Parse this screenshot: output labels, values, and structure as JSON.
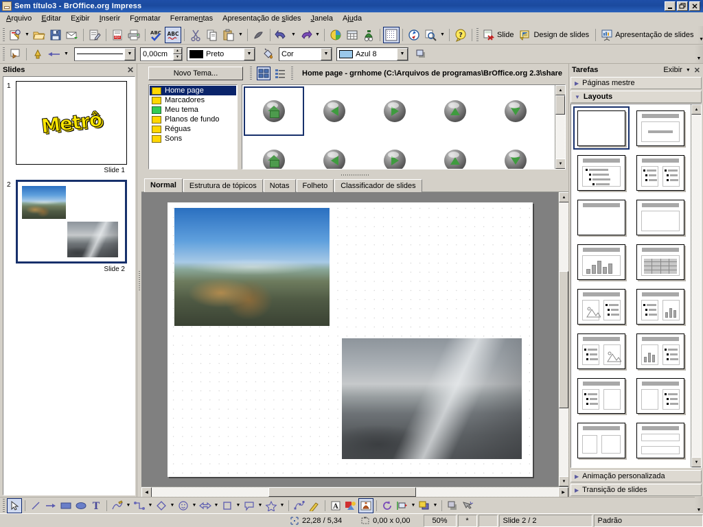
{
  "window": {
    "title": "Sem título3 - BrOffice.org Impress",
    "app_icon": "impress-document-icon",
    "buttons": {
      "minimize": "_",
      "restore": "❐",
      "close": "✕"
    }
  },
  "menubar": {
    "items": [
      {
        "label": "Arquivo",
        "accel": "A"
      },
      {
        "label": "Editar",
        "accel": "E"
      },
      {
        "label": "Exibir",
        "accel": "x"
      },
      {
        "label": "Inserir",
        "accel": "I"
      },
      {
        "label": "Formatar",
        "accel": "o"
      },
      {
        "label": "Ferramentas",
        "accel": "n"
      },
      {
        "label": "Apresentação de slides",
        "accel": "s"
      },
      {
        "label": "Janela",
        "accel": "J"
      },
      {
        "label": "Ajuda",
        "accel": "u"
      }
    ]
  },
  "standard_toolbar": {
    "buttons": [
      {
        "name": "new-document-icon",
        "tip": "Novo"
      },
      {
        "name": "new-document-dropdown-icon",
        "tip": "Novo"
      },
      {
        "name": "open-icon",
        "tip": "Abrir"
      },
      {
        "name": "save-icon",
        "tip": "Salvar"
      },
      {
        "name": "email-document-icon",
        "tip": "Documento como e-mail"
      },
      {
        "name": "edit-file-icon",
        "tip": "Editar arquivo"
      },
      {
        "name": "export-pdf-icon",
        "tip": "Exportar diretamente como PDF"
      },
      {
        "name": "print-icon",
        "tip": "Imprimir arquivo diretamente"
      },
      {
        "name": "spellcheck-icon",
        "tip": "Verificação ortográfica"
      },
      {
        "name": "autospellcheck-icon",
        "tip": "Autoverificação ortográfica"
      },
      {
        "name": "cut-icon",
        "tip": "Cortar"
      },
      {
        "name": "copy-icon",
        "tip": "Copiar"
      },
      {
        "name": "paste-icon",
        "tip": "Colar"
      },
      {
        "name": "paste-dropdown-icon",
        "tip": "Colar"
      },
      {
        "name": "clone-formatting-icon",
        "tip": "Pincel de estilo"
      },
      {
        "name": "undo-icon",
        "tip": "Desfazer"
      },
      {
        "name": "undo-dropdown-icon",
        "tip": "Desfazer"
      },
      {
        "name": "redo-icon",
        "tip": "Refazer"
      },
      {
        "name": "redo-dropdown-icon",
        "tip": "Refazer"
      },
      {
        "name": "insert-chart-icon",
        "tip": "Gráfico"
      },
      {
        "name": "insert-table-icon",
        "tip": "Tabela"
      },
      {
        "name": "gallery-icon",
        "tip": "Galeria"
      },
      {
        "name": "display-grid-icon",
        "tip": "Exibir grade"
      },
      {
        "name": "hyperlink-icon",
        "tip": "Hyperlink"
      },
      {
        "name": "zoom-icon",
        "tip": "Zoom"
      },
      {
        "name": "zoom-dropdown-icon",
        "tip": "Zoom"
      },
      {
        "name": "help-icon",
        "tip": "Ajuda do BrOffice.org"
      }
    ],
    "labeled_buttons": [
      {
        "name": "new-slide-button",
        "label": "Slide",
        "icon": "new-slide-icon"
      },
      {
        "name": "slide-design-button",
        "label": "Design de slides",
        "icon": "slide-design-icon"
      },
      {
        "name": "slide-show-button",
        "label": "Apresentação de slides",
        "icon": "slide-show-icon"
      }
    ]
  },
  "line_and_fill_toolbar": {
    "select_icon": "line-fill-select-icon",
    "line_endpoint_icon": "line-endpoint-icon",
    "arrow_style_icon": "arrow-style-icon",
    "line_style": {
      "name": "line-style-combo",
      "value": ""
    },
    "line_width": {
      "name": "line-width-field",
      "value": "0,00cm"
    },
    "line_color": {
      "name": "line-color-combo",
      "value": "Preto",
      "hex": "#000000"
    },
    "fill_bucket_icon": "fill-bucket-icon",
    "area_style": {
      "name": "area-style-combo",
      "value": "Cor"
    },
    "area_fill": {
      "name": "area-fill-combo",
      "value": "Azul 8",
      "hex": "#99ccee"
    },
    "shadow_icon": "shadow-icon"
  },
  "slides_panel": {
    "title": "Slides",
    "close_icon": "close-icon",
    "slides": [
      {
        "number": "1",
        "label": "Slide 1",
        "selected": false,
        "content": "Metrô"
      },
      {
        "number": "2",
        "label": "Slide 2",
        "selected": true,
        "content": ""
      }
    ]
  },
  "gallery": {
    "new_theme_button": "Novo Tema...",
    "view_icon_button": "gallery-icon-view-icon",
    "view_list_button": "gallery-list-view-icon",
    "title": "Home page - grnhome (C:\\Arquivos de programas\\BrOffice.org 2.3\\share",
    "themes": [
      {
        "label": "Home page",
        "selected": true,
        "folder_color": "#ffd700"
      },
      {
        "label": "Marcadores",
        "selected": false,
        "folder_color": "#ffd700"
      },
      {
        "label": "Meu tema",
        "selected": false,
        "folder_color": "#33cc55"
      },
      {
        "label": "Planos de fundo",
        "selected": false,
        "folder_color": "#ffd700"
      },
      {
        "label": "Réguas",
        "selected": false,
        "folder_color": "#ffd700"
      },
      {
        "label": "Sons",
        "selected": false,
        "folder_color": "#ffd700"
      }
    ],
    "items": [
      {
        "name": "gallery-item-home",
        "glyph": "home",
        "selected": true
      },
      {
        "name": "gallery-item-left",
        "glyph": "left",
        "selected": false
      },
      {
        "name": "gallery-item-right",
        "glyph": "right",
        "selected": false
      },
      {
        "name": "gallery-item-up",
        "glyph": "up",
        "selected": false
      },
      {
        "name": "gallery-item-down",
        "glyph": "down",
        "selected": false
      },
      {
        "name": "gallery-item-home-2",
        "glyph": "home",
        "selected": false
      },
      {
        "name": "gallery-item-left-2",
        "glyph": "left",
        "selected": false
      },
      {
        "name": "gallery-item-right-2",
        "glyph": "right",
        "selected": false
      },
      {
        "name": "gallery-item-up-2",
        "glyph": "up",
        "selected": false
      },
      {
        "name": "gallery-item-down-2",
        "glyph": "down",
        "selected": false
      }
    ]
  },
  "view_tabs": [
    {
      "label": "Normal",
      "selected": true
    },
    {
      "label": "Estrutura de tópicos",
      "selected": false
    },
    {
      "label": "Notas",
      "selected": false
    },
    {
      "label": "Folheto",
      "selected": false
    },
    {
      "label": "Classificador de slides",
      "selected": false
    }
  ],
  "tasks_panel": {
    "title": "Tarefas",
    "view_label": "Exibir",
    "dropdown_icon": "chevron-down-icon",
    "close_icon": "close-icon",
    "sections": [
      {
        "label": "Páginas mestre",
        "open": false
      },
      {
        "label": "Layouts",
        "open": true
      },
      {
        "label": "Animação personalizada",
        "open": false
      },
      {
        "label": "Transição de slides",
        "open": false
      }
    ],
    "layouts": [
      {
        "name": "layout-blank",
        "kind": "blank",
        "selected": true
      },
      {
        "name": "layout-title-subtitle",
        "kind": "title-subtitle",
        "selected": false
      },
      {
        "name": "layout-title-content",
        "kind": "title-bullets",
        "selected": false
      },
      {
        "name": "layout-title-two-content",
        "kind": "title-two-bullets",
        "selected": false
      },
      {
        "name": "layout-title-only",
        "kind": "title-only",
        "selected": false
      },
      {
        "name": "layout-title-object",
        "kind": "title-object",
        "selected": false
      },
      {
        "name": "layout-title-chart",
        "kind": "title-chart",
        "selected": false
      },
      {
        "name": "layout-title-table",
        "kind": "title-table",
        "selected": false
      },
      {
        "name": "layout-title-clipart-content",
        "kind": "title-clip-bullets",
        "selected": false
      },
      {
        "name": "layout-title-content-chart",
        "kind": "title-bullets-chart",
        "selected": false
      },
      {
        "name": "layout-title-content-clipart",
        "kind": "title-bullets-clip",
        "selected": false
      },
      {
        "name": "layout-title-chart-content",
        "kind": "title-chart-bullets",
        "selected": false
      },
      {
        "name": "layout-title-content-object",
        "kind": "title-bullets-obj",
        "selected": false
      },
      {
        "name": "layout-title-content-content",
        "kind": "title-bullets-bullets",
        "selected": false
      },
      {
        "name": "layout-title-object-content",
        "kind": "title-obj-bullets",
        "selected": false
      },
      {
        "name": "layout-title-wide-content",
        "kind": "title-wide",
        "selected": false
      }
    ]
  },
  "drawing_toolbar": {
    "buttons": [
      {
        "name": "select-tool-icon",
        "active": true
      },
      {
        "name": "line-tool-icon",
        "active": false
      },
      {
        "name": "arrow-tool-icon",
        "active": false
      },
      {
        "name": "rectangle-tool-icon",
        "active": false
      },
      {
        "name": "ellipse-tool-icon",
        "active": false
      },
      {
        "name": "text-tool-icon",
        "active": false
      },
      {
        "name": "curve-tool-icon",
        "active": false
      },
      {
        "name": "connector-tool-icon",
        "active": false
      },
      {
        "name": "basic-shapes-icon",
        "active": false
      },
      {
        "name": "symbol-shapes-icon",
        "active": false
      },
      {
        "name": "block-arrows-icon",
        "active": false
      },
      {
        "name": "flowchart-shapes-icon",
        "active": false
      },
      {
        "name": "callout-shapes-icon",
        "active": false
      },
      {
        "name": "stars-shapes-icon",
        "active": false
      },
      {
        "name": "points-icon",
        "active": false
      },
      {
        "name": "glue-points-icon",
        "active": false
      },
      {
        "name": "fontwork-gallery-icon",
        "active": false
      },
      {
        "name": "insert-image-icon",
        "active": false
      },
      {
        "name": "gallery-toggle-icon",
        "active": true
      },
      {
        "name": "rotate-icon",
        "active": false
      },
      {
        "name": "alignment-icon",
        "active": false
      },
      {
        "name": "arrange-icon",
        "active": false
      },
      {
        "name": "shadow-toggle-icon",
        "active": false
      },
      {
        "name": "interaction-icon",
        "active": false
      }
    ]
  },
  "statusbar": {
    "cursor_icon": "cursor-position-icon",
    "position": "22,28 / 5,34",
    "size_icon": "object-size-icon",
    "size": "0,00 x 0,00",
    "zoom": "50%",
    "modified": "*",
    "signature": "",
    "slide_info": "Slide 2 / 2",
    "master": "Padrão"
  }
}
